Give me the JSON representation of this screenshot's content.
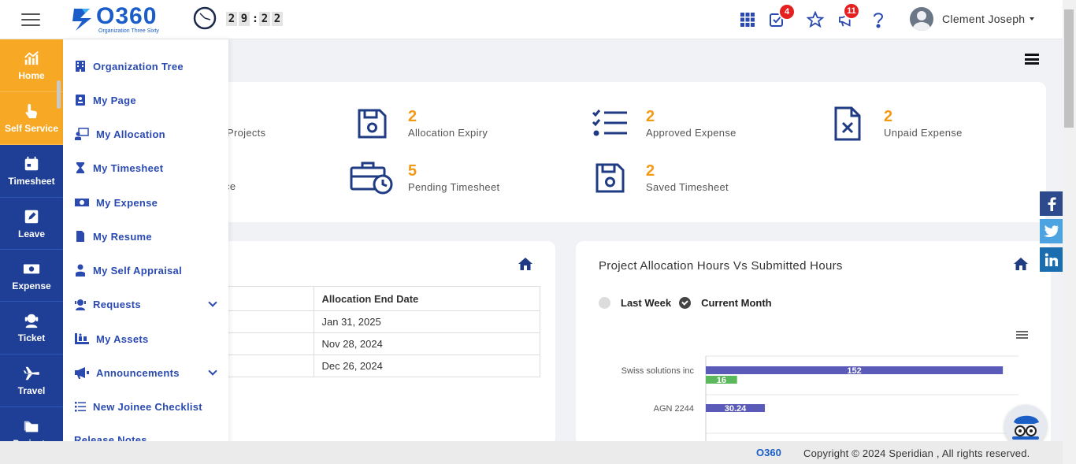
{
  "header": {
    "logo_text": "O360",
    "logo_sub": "Organization Three Sixty",
    "timer": [
      "2",
      "9",
      "2",
      "2"
    ],
    "task_badge": "4",
    "announce_badge": "11",
    "user_name": "Clement Joseph"
  },
  "leftnav": {
    "items": [
      {
        "label": "Home",
        "icon": "chart-icon"
      },
      {
        "label": "Self Service",
        "icon": "hand-pointer-icon"
      },
      {
        "label": "Timesheet",
        "icon": "calendar-icon"
      },
      {
        "label": "Leave",
        "icon": "edit-icon"
      },
      {
        "label": "Expense",
        "icon": "money-icon"
      },
      {
        "label": "Ticket",
        "icon": "headset-icon"
      },
      {
        "label": "Travel",
        "icon": "plane-icon"
      },
      {
        "label": "Projects",
        "icon": "folder-icon"
      }
    ]
  },
  "submenu": {
    "items": [
      {
        "label": "Organization Tree"
      },
      {
        "label": "My Page"
      },
      {
        "label": "My Allocation"
      },
      {
        "label": "My Timesheet"
      },
      {
        "label": "My Expense"
      },
      {
        "label": "My Resume"
      },
      {
        "label": "My Self Appraisal"
      },
      {
        "label": "Requests"
      },
      {
        "label": "My Assets"
      },
      {
        "label": "Announcements"
      },
      {
        "label": "New Joinee Checklist"
      },
      {
        "label": "Release Notes"
      }
    ]
  },
  "stats": {
    "partial_projects": "Projects",
    "partial_ance": "ance",
    "allocation_expiry": {
      "num": "2",
      "label": "Allocation Expiry"
    },
    "approved_expense": {
      "num": "2",
      "label": "Approved Expense"
    },
    "unpaid_expense": {
      "num": "2",
      "label": "Unpaid Expense"
    },
    "pending_timesheet": {
      "num": "5",
      "label": "Pending Timesheet"
    },
    "saved_timesheet": {
      "num": "2",
      "label": "Saved Timesheet"
    }
  },
  "allocation_table": {
    "header": "Allocation End Date",
    "rows": [
      "Jan 31, 2025",
      "Nov 28, 2024",
      "Dec 26, 2024"
    ]
  },
  "chart": {
    "title": "Project Allocation Hours Vs Submitted Hours",
    "options": [
      "Last Week",
      "Current Month"
    ],
    "selected": "Current Month"
  },
  "chart_data": {
    "type": "bar",
    "orientation": "horizontal",
    "categories": [
      "Swiss solutions inc",
      "AGN 2244"
    ],
    "series": [
      {
        "values": [
          152,
          30.24
        ],
        "color": "#5a5ab9"
      },
      {
        "values": [
          16,
          null
        ],
        "color": "#5cb85c"
      }
    ],
    "xlim": [
      0,
      160
    ]
  },
  "footer": {
    "logo": "O360",
    "copyright": "Copyright © 2024 Speridian , All rights reserved."
  },
  "colors": {
    "nav": "#1e3f95",
    "active": "#f7a926",
    "accent": "#f29a16",
    "link": "#2a4ab0"
  }
}
